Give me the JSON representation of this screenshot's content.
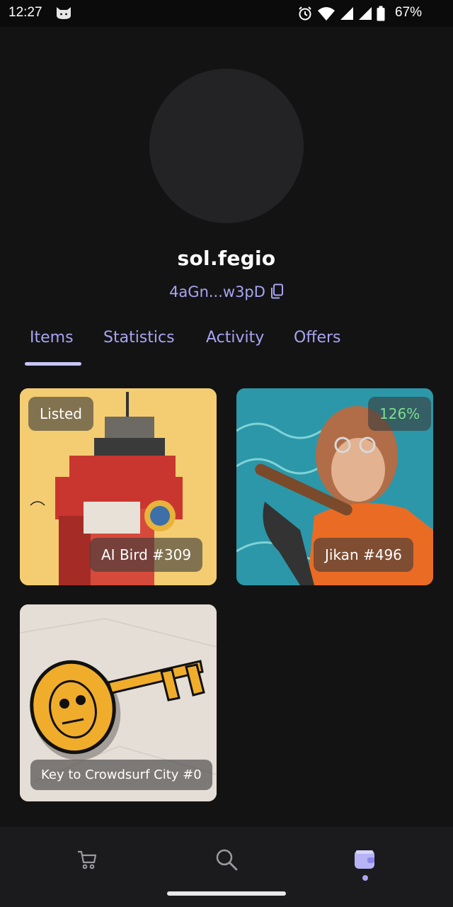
{
  "status_bar": {
    "time": "12:27",
    "battery": "67%"
  },
  "profile": {
    "username": "sol.fegio",
    "address": "4aGn...w3pD"
  },
  "tabs": [
    {
      "label": "Items",
      "active": true
    },
    {
      "label": "Statistics",
      "active": false
    },
    {
      "label": "Activity",
      "active": false
    },
    {
      "label": "Offers",
      "active": false
    }
  ],
  "items": [
    {
      "name": "AI Bird #309",
      "badge": "Listed"
    },
    {
      "name": "Jikan #496",
      "badge": "126%"
    },
    {
      "name": "Key to Crowdsurf City #0",
      "badge": ""
    }
  ],
  "bottom_nav": [
    {
      "icon": "cart-icon"
    },
    {
      "icon": "search-icon"
    },
    {
      "icon": "wallet-icon",
      "active": true
    }
  ],
  "colors": {
    "accent": "#a9a4f2",
    "background": "#131314",
    "badge_green": "#7be08c"
  }
}
